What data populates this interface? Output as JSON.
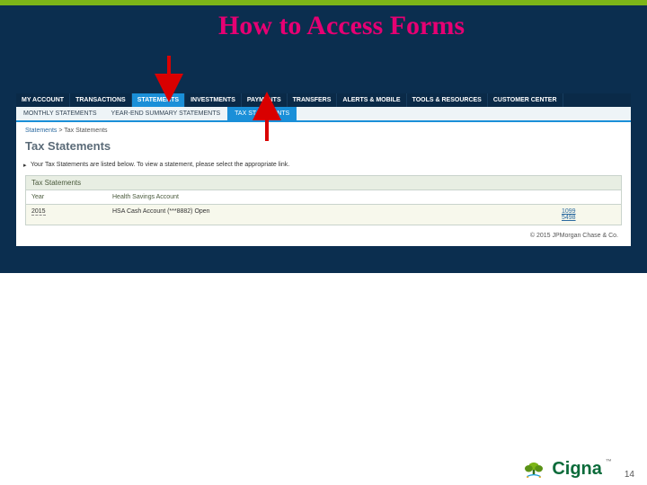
{
  "slide": {
    "title": "How to Access Forms",
    "page_number": "14"
  },
  "nav_primary": [
    "MY ACCOUNT",
    "TRANSACTIONS",
    "STATEMENTS",
    "INVESTMENTS",
    "PAYMENTS",
    "TRANSFERS",
    "ALERTS & MOBILE",
    "TOOLS & RESOURCES",
    "CUSTOMER CENTER"
  ],
  "nav_primary_active": 2,
  "nav_secondary": [
    "MONTHLY STATEMENTS",
    "YEAR-END SUMMARY STATEMENTS",
    "TAX STATEMENTS"
  ],
  "nav_secondary_active": 2,
  "breadcrumb": {
    "parent": "Statements",
    "sep": " > ",
    "current": "Tax Statements"
  },
  "page_heading": "Tax Statements",
  "intro_text": "Your Tax Statements are listed below. To view a statement, please select the appropriate link.",
  "box_heading": "Tax Statements",
  "columns": {
    "year": "Year",
    "account": "Health Savings Account"
  },
  "row": {
    "year": "2015",
    "account": "HSA Cash Account (***8882) Open",
    "links": {
      "a": "1099",
      "b": "5498"
    }
  },
  "copyright": "© 2015 JPMorgan Chase & Co.",
  "brand": "Cigna"
}
